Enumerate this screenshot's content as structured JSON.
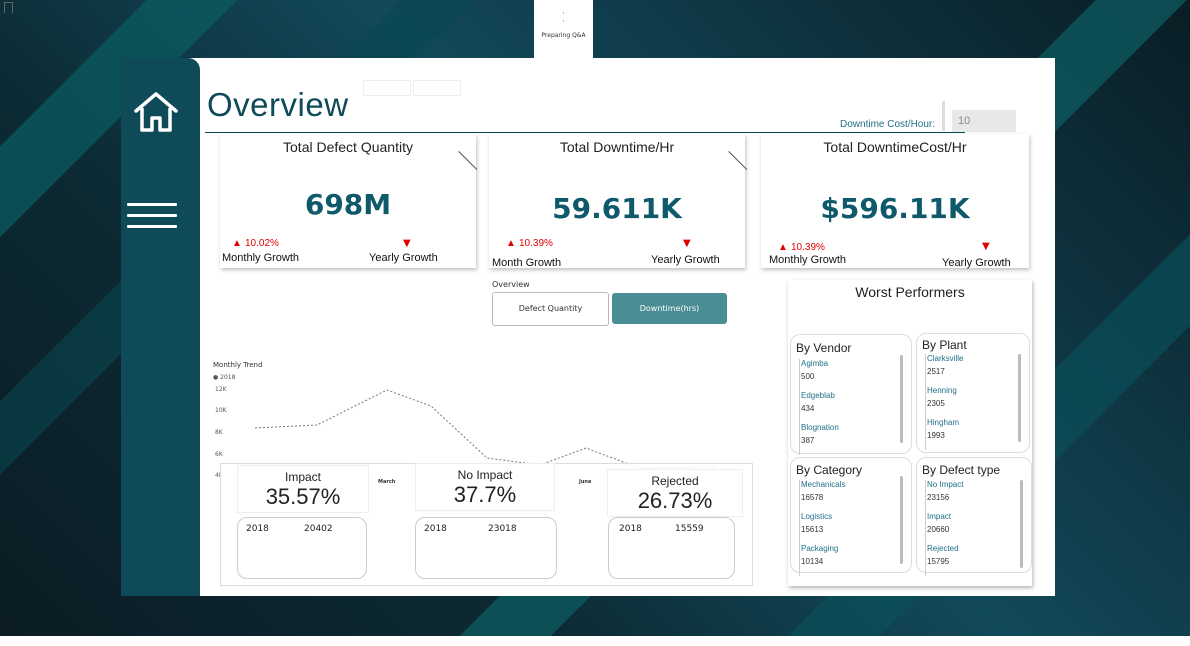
{
  "qa": {
    "text": "Preparing Q&A"
  },
  "report": {
    "title": "Overview",
    "cost_label": "Downtime Cost/Hour:",
    "cost_value": "10"
  },
  "kpis": [
    {
      "title": "Total Defect Quantity",
      "value": "698M",
      "monthly_pct": "10.02%",
      "monthly_label": "Monthly Growth",
      "yearly_label": "Yearly Growth"
    },
    {
      "title": "Total Downtime/Hr",
      "value": "59.611K",
      "monthly_pct": "10.39%",
      "monthly_label": "Month Growth",
      "yearly_label": "Yearly Growth"
    },
    {
      "title": "Total DowntimeCost/Hr",
      "value": "$596.11K",
      "monthly_pct": "10.39%",
      "monthly_label": "Monthly Growth",
      "yearly_label": "Yearly Growth"
    }
  ],
  "toggle": {
    "label": "Overview",
    "defect": "Defect Quantity",
    "downtime": "Downtime(hrs)"
  },
  "trend": {
    "title": "Monthly Trend",
    "legend": "2018",
    "yticks": [
      "12K",
      "10K",
      "8K",
      "6K",
      "4K"
    ],
    "xticks": [
      "March",
      "June"
    ]
  },
  "impact_cards": [
    {
      "title": "Impact",
      "value": "35.57%",
      "year": "2018",
      "count": "20402"
    },
    {
      "title": "No Impact",
      "value": "37.7%",
      "year": "2018",
      "count": "23018"
    },
    {
      "title": "Rejected",
      "value": "26.73%",
      "year": "2018",
      "count": "15559"
    }
  ],
  "worst": {
    "title": "Worst Performers",
    "panels": [
      {
        "title": "By Vendor",
        "items": [
          {
            "name": "Agimba",
            "value": "500"
          },
          {
            "name": "Edgeblab",
            "value": "434"
          },
          {
            "name": "Blognation",
            "value": "387"
          }
        ]
      },
      {
        "title": "By Plant",
        "items": [
          {
            "name": "Clarksville",
            "value": "2517"
          },
          {
            "name": "Henning",
            "value": "2305"
          },
          {
            "name": "Hingham",
            "value": "1993"
          }
        ]
      },
      {
        "title": "By Category",
        "items": [
          {
            "name": "Mechanicals",
            "value": "16578"
          },
          {
            "name": "Logistics",
            "value": "15613"
          },
          {
            "name": "Packaging",
            "value": "10134"
          }
        ]
      },
      {
        "title": "By Defect type",
        "items": [
          {
            "name": "No Impact",
            "value": "23156"
          },
          {
            "name": "Impact",
            "value": "20660"
          },
          {
            "name": "Rejected",
            "value": "15795"
          }
        ]
      }
    ]
  }
}
